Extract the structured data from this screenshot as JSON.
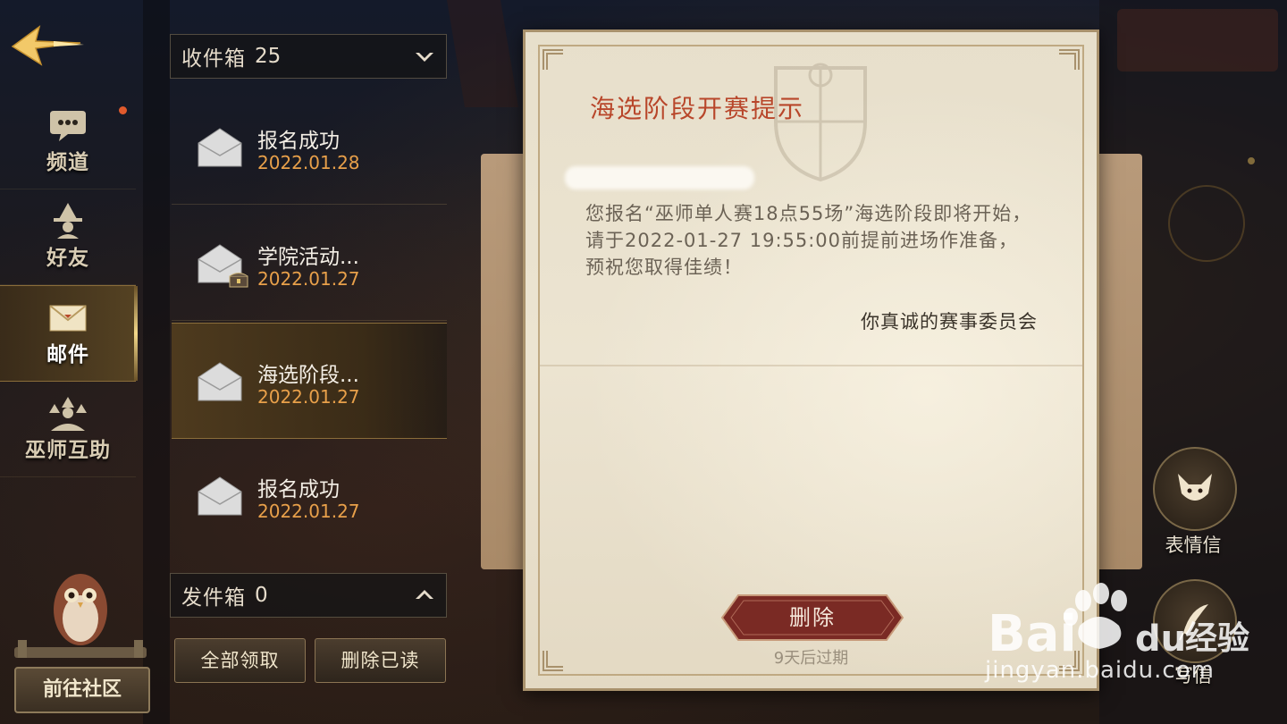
{
  "nav": {
    "items": [
      {
        "label": "频道",
        "icon": "chat-bubble-icon"
      },
      {
        "label": "好友",
        "icon": "wizard-icon"
      },
      {
        "label": "邮件",
        "icon": "envelope-icon"
      },
      {
        "label": "巫师互助",
        "icon": "wizard-group-icon"
      }
    ],
    "active_index": 2,
    "community_label": "前往社区"
  },
  "inbox": {
    "label": "收件箱",
    "count": "25",
    "mails": [
      {
        "title": "报名成功",
        "date": "2022.01.28",
        "has_attachment": false
      },
      {
        "title": "学院活动...",
        "date": "2022.01.27",
        "has_attachment": true
      },
      {
        "title": "海选阶段...",
        "date": "2022.01.27",
        "has_attachment": false,
        "selected": true
      },
      {
        "title": "报名成功",
        "date": "2022.01.27",
        "has_attachment": false
      }
    ]
  },
  "outbox": {
    "label": "发件箱",
    "count": "0"
  },
  "buttons": {
    "claim_all": "全部领取",
    "delete_read": "删除已读"
  },
  "letter": {
    "title": "海选阶段开赛提示",
    "body": "您报名“巫师单人赛18点55场”海选阶段即将开始，请于2022-01-27 19:55:00前提前进场作准备，预祝您取得佳绩！",
    "signature": "你真诚的赛事委员会",
    "delete_label": "删除",
    "expire_note": "9天后过期"
  },
  "actions": {
    "emoji_letter": "表情信",
    "write_letter": "写信"
  },
  "watermark": {
    "logo_text": "Bai du 经验",
    "url": "jingyan.baidu.com"
  },
  "colors": {
    "title_red": "#b8462a",
    "date_orange": "#e8a04a",
    "delete_red": "#8a2f28"
  }
}
